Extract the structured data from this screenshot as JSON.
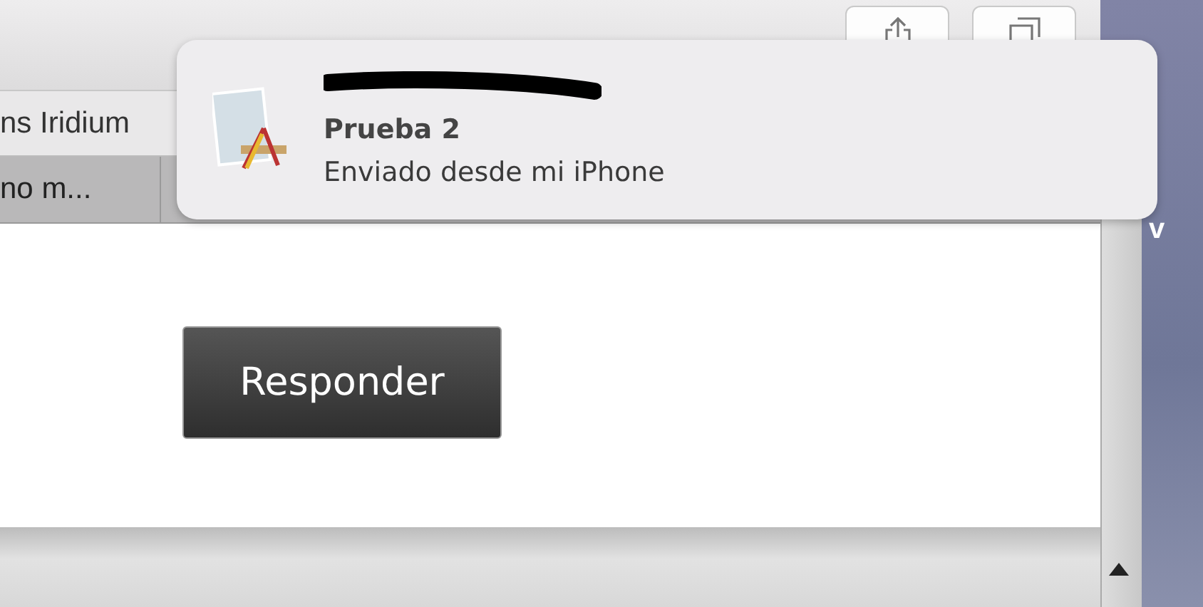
{
  "window": {
    "tab_row": {
      "label": "ns Iridium"
    },
    "list_row": {
      "label": "no m..."
    },
    "reply_button": {
      "label": "Responder"
    }
  },
  "background_window": {
    "label": "v"
  },
  "notification": {
    "subject": "Prueba 2",
    "preview": "Enviado desde mi iPhone"
  }
}
